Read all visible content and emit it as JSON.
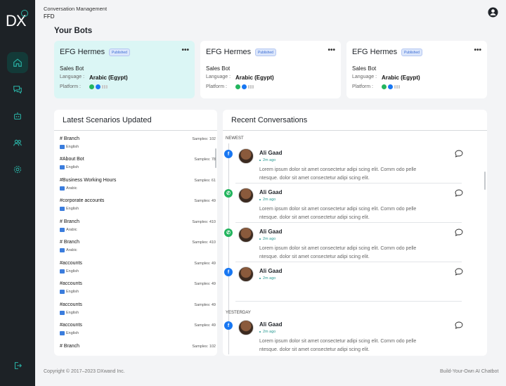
{
  "logo": {
    "text": "DX"
  },
  "header": {
    "breadcrumb": "Conversation Management",
    "subtitle": "FFD",
    "account_icon": "user-circle-icon"
  },
  "sidebar": {
    "items": [
      {
        "icon": "home-icon",
        "active": true
      },
      {
        "icon": "chat-icon",
        "active": false
      },
      {
        "icon": "bot-icon",
        "active": false
      },
      {
        "icon": "users-icon",
        "active": false
      },
      {
        "icon": "settings-icon",
        "active": false
      }
    ],
    "bottom_icon": "logout-icon"
  },
  "bots_section": {
    "title": "Your Bots"
  },
  "bots": [
    {
      "name": "EFG Hermes",
      "status": "Published",
      "type": "Sales Bot",
      "language_label": "Language :",
      "language": "Arabic (Egypt)",
      "platform_label": "Platform :",
      "highlight": true
    },
    {
      "name": "EFG Hermes",
      "status": "Published",
      "type": "Sales Bot",
      "language_label": "Language :",
      "language": "Arabic (Egypt)",
      "platform_label": "Platform :",
      "highlight": false
    },
    {
      "name": "EFG Hermes",
      "status": "Published",
      "type": "Sales Bot",
      "language_label": "Language :",
      "language": "Arabic (Egypt)",
      "platform_label": "Platform :",
      "highlight": false
    }
  ],
  "more_label": "•••",
  "scenarios": {
    "title": "Latest Scenarios Updated",
    "rows": [
      {
        "name": "# Branch",
        "samples": "Samples: 102",
        "language": "English"
      },
      {
        "name": "#About Bot",
        "samples": "Samples: 78",
        "language": "English"
      },
      {
        "name": "#Business Working Hours",
        "samples": "Samples: 61",
        "language": "Arabic"
      },
      {
        "name": "#corporate accounts",
        "samples": "Samples: 49",
        "language": "English"
      },
      {
        "name": "# Branch",
        "samples": "Samples: 410",
        "language": "Arabic"
      },
      {
        "name": "# Branch",
        "samples": "Samples: 410",
        "language": "Arabic"
      },
      {
        "name": "#accounts",
        "samples": "Samples: 49",
        "language": "English"
      },
      {
        "name": "#accounts",
        "samples": "Samples: 49",
        "language": "English"
      },
      {
        "name": "#accounts",
        "samples": "Samples: 49",
        "language": "English"
      },
      {
        "name": "#accounts",
        "samples": "Samples: 49",
        "language": "English"
      },
      {
        "name": "# Branch",
        "samples": "Samples: 102",
        "language": ""
      }
    ]
  },
  "conversations": {
    "title": "Recent Conversations",
    "groups": [
      {
        "label": "NEWEST",
        "items": [
          {
            "platform": "facebook",
            "name": "Ali Gaad",
            "time": "2m ago",
            "message": "Lorem ipsum dolor sit amet consectetur adipi scing elit. Comm odo pelle ntesque. dolor sit amet consectetur adipi scing elit."
          },
          {
            "platform": "whatsapp",
            "name": "Ali Gaad",
            "time": "2m ago",
            "message": "Lorem ipsum dolor sit amet consectetur adipi scing elit. Comm odo pelle ntesque. dolor sit amet consectetur adipi scing elit."
          },
          {
            "platform": "whatsapp",
            "name": "Ali Gaad",
            "time": "2m ago",
            "message": "Lorem ipsum dolor sit amet consectetur adipi scing elit. Comm odo pelle ntesque. dolor sit amet consectetur adipi scing elit."
          },
          {
            "platform": "facebook",
            "name": "Ali Gaad",
            "time": "2m ago",
            "message": ""
          }
        ]
      },
      {
        "label": "YESTERDAY",
        "items": [
          {
            "platform": "facebook",
            "name": "Ali Gaad",
            "time": "2m ago",
            "message": "Lorem ipsum dolor sit amet consectetur adipi scing elit. Comm odo pelle ntesque. dolor sit amet consectetur adipi scing elit."
          }
        ]
      }
    ]
  },
  "footer": {
    "copyright": "Copyright © 2017–2023 DXwand Inc.",
    "tagline": "Build-Your-Own AI Chatbot"
  },
  "colors": {
    "sidebar": "#1d2226",
    "accent": "#2ab3a6",
    "highlight_card": "#dbf6f5",
    "facebook": "#1877f2",
    "whatsapp": "#23b55e"
  }
}
